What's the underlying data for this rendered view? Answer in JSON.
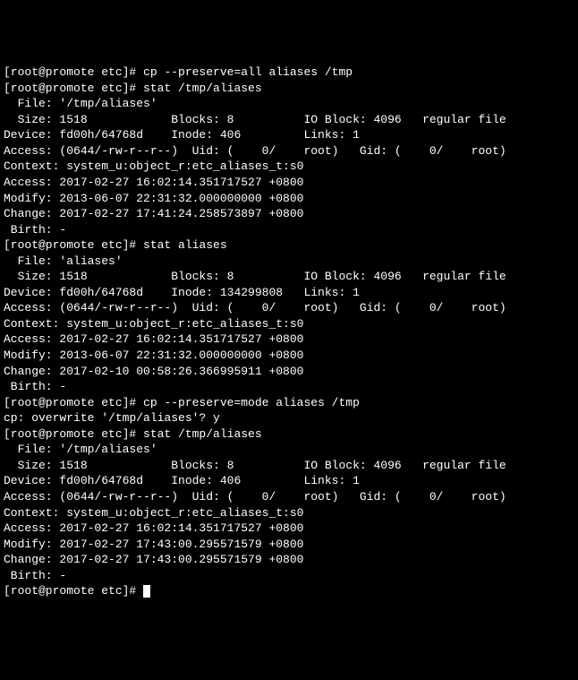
{
  "lines": [
    "[root@promote etc]# cp --preserve=all aliases /tmp",
    "[root@promote etc]# stat /tmp/aliases",
    "  File: '/tmp/aliases'",
    "  Size: 1518            Blocks: 8          IO Block: 4096   regular file",
    "Device: fd00h/64768d    Inode: 406         Links: 1",
    "Access: (0644/-rw-r--r--)  Uid: (    0/    root)   Gid: (    0/    root)",
    "Context: system_u:object_r:etc_aliases_t:s0",
    "Access: 2017-02-27 16:02:14.351717527 +0800",
    "Modify: 2013-06-07 22:31:32.000000000 +0800",
    "Change: 2017-02-27 17:41:24.258573897 +0800",
    " Birth: -",
    "[root@promote etc]# stat aliases",
    "  File: 'aliases'",
    "  Size: 1518            Blocks: 8          IO Block: 4096   regular file",
    "Device: fd00h/64768d    Inode: 134299808   Links: 1",
    "Access: (0644/-rw-r--r--)  Uid: (    0/    root)   Gid: (    0/    root)",
    "Context: system_u:object_r:etc_aliases_t:s0",
    "Access: 2017-02-27 16:02:14.351717527 +0800",
    "Modify: 2013-06-07 22:31:32.000000000 +0800",
    "Change: 2017-02-10 00:58:26.366995911 +0800",
    " Birth: -",
    "[root@promote etc]# cp --preserve=mode aliases /tmp",
    "cp: overwrite '/tmp/aliases'? y",
    "[root@promote etc]# stat /tmp/aliases",
    "  File: '/tmp/aliases'",
    "  Size: 1518            Blocks: 8          IO Block: 4096   regular file",
    "Device: fd00h/64768d    Inode: 406         Links: 1",
    "Access: (0644/-rw-r--r--)  Uid: (    0/    root)   Gid: (    0/    root)",
    "Context: system_u:object_r:etc_aliases_t:s0",
    "Access: 2017-02-27 16:02:14.351717527 +0800",
    "Modify: 2017-02-27 17:43:00.295571579 +0800",
    "Change: 2017-02-27 17:43:00.295571579 +0800",
    " Birth: -",
    "[root@promote etc]# "
  ]
}
